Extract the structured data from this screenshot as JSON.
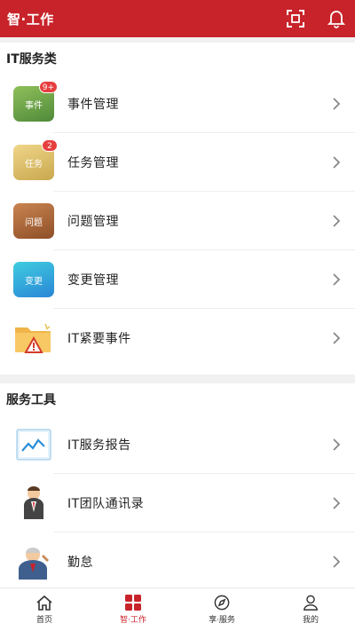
{
  "header": {
    "title": "智·工作"
  },
  "sections": [
    {
      "title": "IT服务类",
      "items": [
        {
          "label": "事件管理",
          "icon_text": "事件",
          "badge": "9+",
          "icon": "events-icon"
        },
        {
          "label": "任务管理",
          "icon_text": "任务",
          "badge": "2",
          "icon": "tasks-icon"
        },
        {
          "label": "问题管理",
          "icon_text": "问题",
          "icon": "problems-icon"
        },
        {
          "label": "变更管理",
          "icon_text": "变更",
          "icon": "changes-icon"
        },
        {
          "label": "IT紧要事件",
          "icon": "warning-folder-icon"
        }
      ]
    },
    {
      "title": "服务工具",
      "items": [
        {
          "label": "IT服务报告",
          "icon": "chart-report-icon"
        },
        {
          "label": "IT团队通讯录",
          "icon": "contact-person-icon"
        },
        {
          "label": "勤怠",
          "icon": "attendance-person-icon"
        }
      ]
    }
  ],
  "tabbar": {
    "tabs": [
      {
        "label": "首页",
        "icon": "home-icon"
      },
      {
        "label": "智·工作",
        "icon": "grid-icon",
        "active": true
      },
      {
        "label": "享·服务",
        "icon": "compass-icon"
      },
      {
        "label": "我的",
        "icon": "person-icon"
      }
    ]
  },
  "colors": {
    "brand": "#c8232a",
    "badge": "#e63e3e"
  }
}
